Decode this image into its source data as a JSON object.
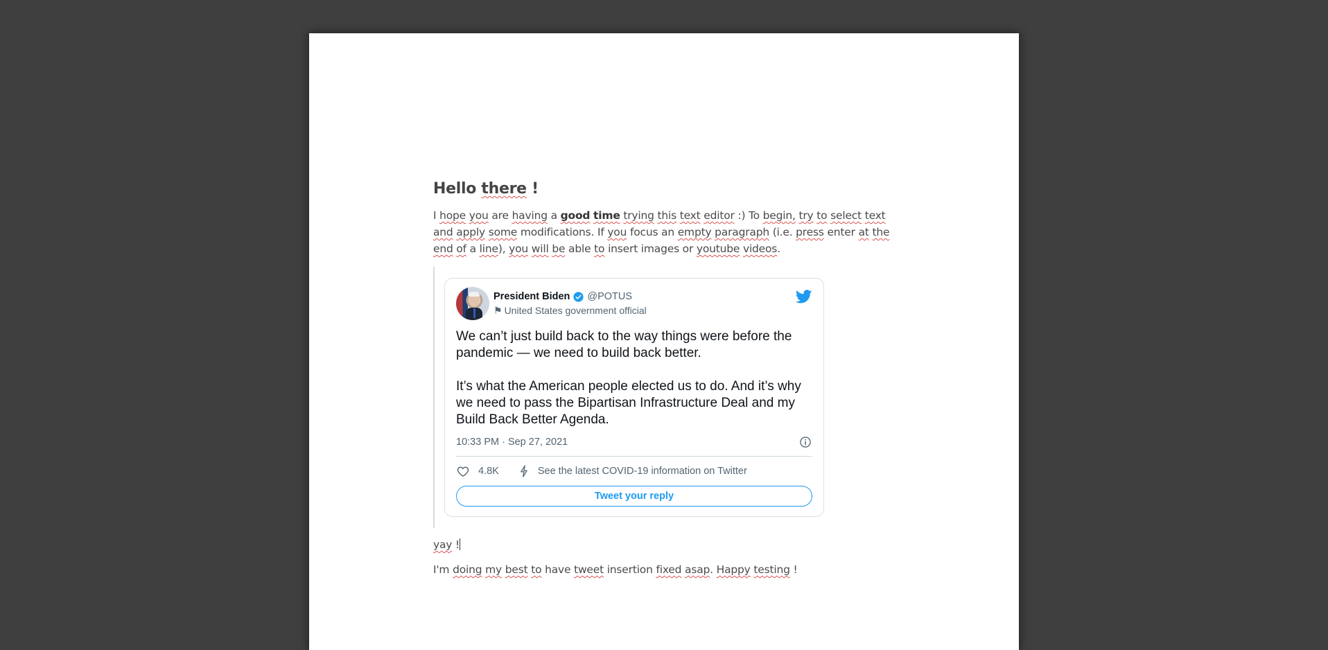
{
  "editor": {
    "heading": [
      "Hello",
      "there",
      "!"
    ],
    "intro": {
      "w1": "I",
      "hope": "hope",
      "you": "you",
      "are": "are",
      "having": "having",
      "a": "a",
      "good": "good",
      "time": "time",
      "trying": "trying",
      "this": "this",
      "text": "text",
      "editor": "editor",
      "smile": ":) To",
      "begin": "begin,",
      "try": "try",
      "to": "to",
      "select": "select",
      "text2": "text",
      "and": "and",
      "apply": "apply",
      "some": "some",
      "modifications": "modifications. If",
      "you2": "you",
      "focus": "focus an",
      "empty": "empty",
      "paragraph": "paragraph",
      "ie": "(i.e.",
      "press": "press",
      "enter": "enter",
      "at": "at",
      "the": "the",
      "end": "end",
      "of": "of",
      "a2": "a",
      "line": "line",
      "close": "),",
      "you3": "you",
      "will": "will",
      "be": "be",
      "able": "able",
      "to2": "to",
      "insert": "insert images or",
      "youtube": "youtube",
      "videos": "videos",
      "dot": "."
    },
    "yay": [
      "yay",
      "!"
    ],
    "closing": {
      "im": "I'm",
      "doing": "doing",
      "my": "my",
      "best": "best",
      "to": "to",
      "have": "have",
      "tweet": "tweet",
      "insertion": "insertion",
      "fixed": "fixed",
      "asap": "asap",
      "dot": ".",
      "happy": "Happy",
      "testing": "testing",
      "bang": "!"
    }
  },
  "tweet": {
    "name": "President Biden",
    "handle": "@POTUS",
    "label": "United States government official",
    "text_p1": "We can’t just build back to the way things were before the pandemic — we need to build back better.",
    "text_p2": "It’s what the American people elected us to do. And it’s why we need to pass the Bipartisan Infrastructure Deal and my Build Back Better Agenda.",
    "timestamp": "10:33 PM · Sep 27, 2021",
    "likes": "4.8K",
    "covid_link": "See the latest COVID-19 information on Twitter",
    "reply_button": "Tweet your reply",
    "colors": {
      "accent": "#1d9bf0",
      "secondary_text": "#536471"
    }
  }
}
